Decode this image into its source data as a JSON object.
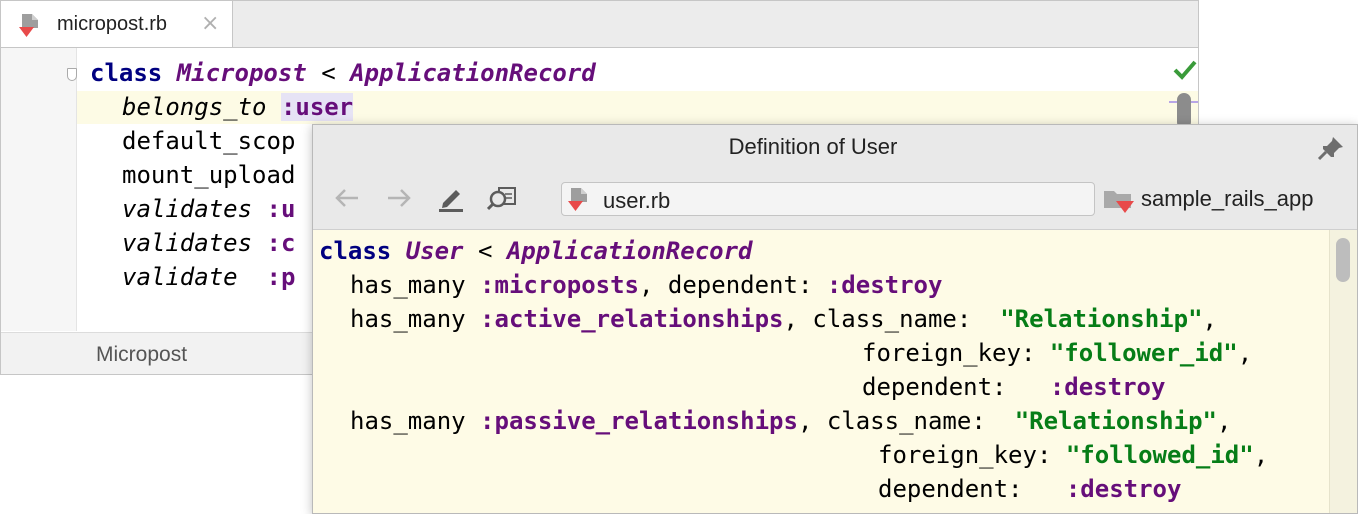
{
  "editor": {
    "tab_label": "micropost.rb",
    "close_glyph": "×",
    "lines": [
      {
        "kw": "class",
        "cls": "Micropost",
        "op": " < ",
        "parent": "ApplicationRecord"
      },
      {
        "meth": "belongs_to",
        "sym": ":user"
      },
      {
        "text": "default_scop"
      },
      {
        "text": "mount_upload"
      },
      {
        "meth": "validates",
        "sym": ":u"
      },
      {
        "meth": "validates",
        "sym": ":c"
      },
      {
        "meth": "validate",
        "sym": ":p"
      }
    ],
    "breadcrumb": "Micropost",
    "status_icon": "check-icon"
  },
  "popup": {
    "title": "Definition of User",
    "file_path": "user.rb",
    "project_name": "sample_rails_app",
    "toolbar_icons": [
      "back-arrow-icon",
      "forward-arrow-icon",
      "edit-source-icon",
      "find-usages-icon"
    ],
    "code": {
      "l1": {
        "kw": "class",
        "cls": "User",
        "op": " < ",
        "parent": "ApplicationRecord"
      },
      "l2": {
        "a": "has_many ",
        "b": ":microposts",
        "c": ", dependent: ",
        "d": ":destroy"
      },
      "l3": {
        "a": "has_many ",
        "b": ":active_relationships",
        "c": ", class_name:  ",
        "d": "\"Relationship\"",
        "e": ","
      },
      "l4": {
        "a": "foreign_key: ",
        "b": "\"follower_id\"",
        "c": ","
      },
      "l5": {
        "a": "dependent:   ",
        "b": ":destroy"
      },
      "l6": {
        "a": "has_many ",
        "b": ":passive_relationships",
        "c": ", class_name:  ",
        "d": "\"Relationship\"",
        "e": ","
      },
      "l7": {
        "a": "foreign_key: ",
        "b": "\"followed_id\"",
        "c": ","
      },
      "l8": {
        "a": "dependent:   ",
        "b": ":destroy"
      }
    }
  },
  "colors": {
    "keyword": "#000080",
    "class_name": "#660e7a",
    "symbol": "#660e7a",
    "string": "#067d17",
    "popup_background": "#fefbe6",
    "status_ok": "#3a9b3a"
  }
}
